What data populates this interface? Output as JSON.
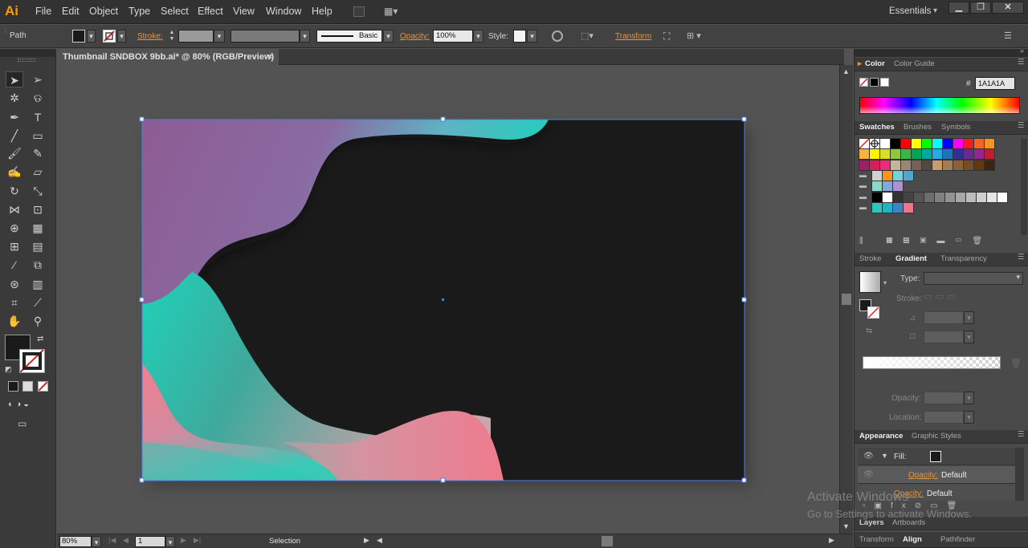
{
  "app": {
    "logo": "Ai",
    "workspace": "Essentials"
  },
  "menu": [
    "File",
    "Edit",
    "Object",
    "Type",
    "Select",
    "Effect",
    "View",
    "Window",
    "Help"
  ],
  "control": {
    "selection_type": "Path",
    "stroke_label": "Stroke:",
    "brush_label": "Basic",
    "opacity_label": "Opacity:",
    "opacity_value": "100%",
    "style_label": "Style:",
    "transform_label": "Transform"
  },
  "document": {
    "tab_title": "Thumbnail SNDBOX 9bb.ai* @ 80% (RGB/Preview)",
    "close": "×"
  },
  "status": {
    "zoom": "80%",
    "artboard": "1",
    "tool": "Selection"
  },
  "panels": {
    "color": {
      "tabs": [
        "Color",
        "Color Guide"
      ],
      "hash": "#",
      "hex": "1A1A1A"
    },
    "swatches": {
      "tabs": [
        "Swatches",
        "Brushes",
        "Symbols"
      ]
    },
    "gradient": {
      "tabs": [
        "Stroke",
        "Gradient",
        "Transparency"
      ],
      "type_label": "Type:",
      "stroke_label": "Stroke:",
      "opacity_label": "Opacity:",
      "location_label": "Location:"
    },
    "appearance": {
      "tabs": [
        "Appearance",
        "Graphic Styles"
      ],
      "fill_label": "Fill:",
      "opacity1": "Opacity:",
      "default1": "Default",
      "opacity2": "Opacity:",
      "default2": "Default"
    },
    "layers": {
      "tabs": [
        "Layers",
        "Artboards"
      ]
    },
    "align": {
      "tabs": [
        "Transform",
        "Align",
        "Pathfinder"
      ]
    }
  },
  "watermark": {
    "line1": "Activate Windows",
    "line2": "Go to Settings to activate Windows."
  },
  "colors": {
    "artboard": "#1A1A1A",
    "teal": "#1ecbb8",
    "purple": "#8a5e95",
    "pink": "#ec7b8e",
    "accent": "#e8963a"
  }
}
